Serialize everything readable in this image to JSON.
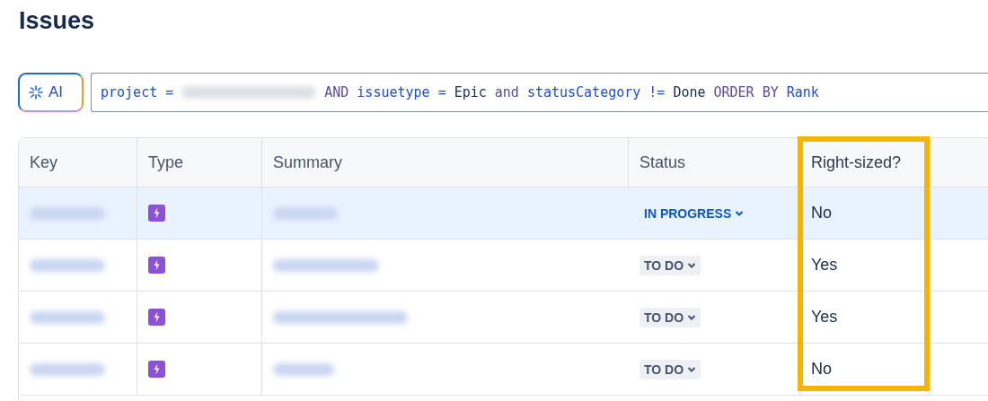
{
  "page": {
    "title": "Issues"
  },
  "search": {
    "ai_button": "AI",
    "query": [
      {
        "kind": "field",
        "text": "project"
      },
      {
        "kind": "operator",
        "text": "="
      },
      {
        "kind": "redacted"
      },
      {
        "kind": "keyword",
        "text": "AND"
      },
      {
        "kind": "field",
        "text": "issuetype"
      },
      {
        "kind": "operator",
        "text": "="
      },
      {
        "kind": "value",
        "text": "Epic"
      },
      {
        "kind": "keyword",
        "text": "and"
      },
      {
        "kind": "field",
        "text": "statusCategory"
      },
      {
        "kind": "operator",
        "text": "!="
      },
      {
        "kind": "value",
        "text": "Done"
      },
      {
        "kind": "keyword",
        "text": "ORDER BY"
      },
      {
        "kind": "field",
        "text": "Rank"
      }
    ]
  },
  "table": {
    "columns": [
      {
        "label": "Key",
        "highlighted": false
      },
      {
        "label": "Type",
        "highlighted": false
      },
      {
        "label": "Summary",
        "highlighted": false
      },
      {
        "label": "Status",
        "highlighted": false
      },
      {
        "label": "Right-sized?",
        "highlighted": true
      }
    ],
    "rows": [
      {
        "selected": true,
        "status": {
          "kind": "in_progress",
          "label": "IN PROGRESS"
        },
        "right_sized": "No"
      },
      {
        "selected": false,
        "status": {
          "kind": "todo",
          "label": "TO DO"
        },
        "right_sized": "Yes"
      },
      {
        "selected": false,
        "status": {
          "kind": "todo",
          "label": "TO DO"
        },
        "right_sized": "Yes"
      },
      {
        "selected": false,
        "status": {
          "kind": "todo",
          "label": "TO DO"
        },
        "right_sized": "No"
      }
    ]
  }
}
